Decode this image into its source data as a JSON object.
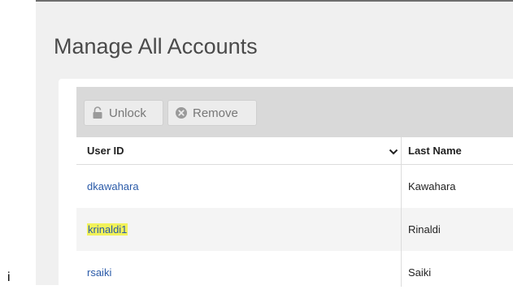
{
  "page": {
    "title": "Manage All Accounts"
  },
  "toolbar": {
    "unlock_label": "Unlock",
    "remove_label": "Remove"
  },
  "table": {
    "columns": [
      "User ID",
      "Last Name"
    ],
    "rows": [
      {
        "user_id": "dkawahara",
        "last_name": "Kawahara",
        "highlighted": false
      },
      {
        "user_id": "krinaldi1",
        "last_name": "Rinaldi",
        "highlighted": true
      },
      {
        "user_id": "rsaiki",
        "last_name": "Saiki",
        "highlighted": false
      }
    ]
  },
  "stray_text": "i",
  "colors": {
    "link": "#2a5aa8",
    "highlight": "#f2f25a",
    "toolbar_bg": "#d9d9d9",
    "frame_bg": "#f0f0f0"
  },
  "icons": {
    "unlock": "padlock-icon",
    "remove": "remove-circle-icon",
    "sort": "chevron-down-icon"
  }
}
